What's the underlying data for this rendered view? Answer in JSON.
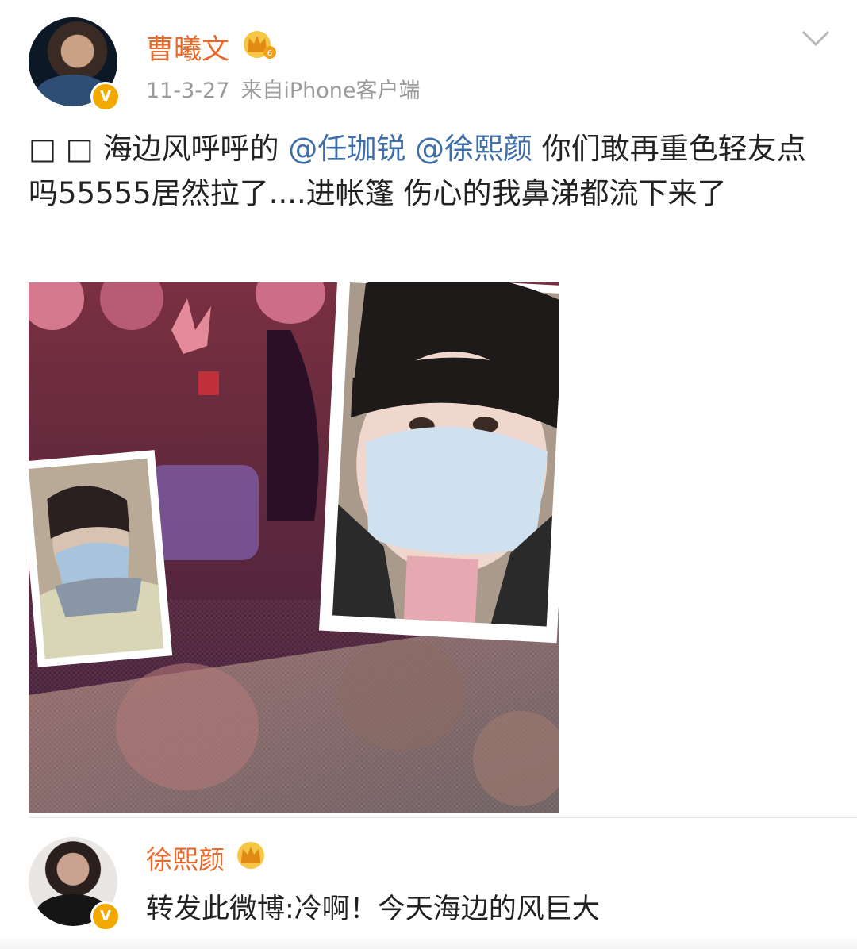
{
  "post": {
    "author": "曹曦文",
    "date": "11-3-27",
    "source": "来自iPhone客户端",
    "text_boxes": "□ □",
    "text_part1": "海边风呼呼的",
    "mention1": "@任珈锐",
    "mention2": "@徐熙颜",
    "text_part2": "你们敢再重色轻友点吗55555居然拉了....进帐篷 伤心的我鼻涕都流下来了",
    "verified_badge": "V",
    "icons": [
      "crown-badge-icon",
      "chevron-down-icon",
      "verified-icon"
    ]
  },
  "repost": {
    "author": "徐熙颜",
    "text": "转发此微博:冷啊！今天海边的风巨大",
    "verified_badge": "V"
  },
  "colors": {
    "username": "#e8692a",
    "mention": "#3f6ea8",
    "meta": "#9a9a9a",
    "verified": "#f2a900"
  }
}
